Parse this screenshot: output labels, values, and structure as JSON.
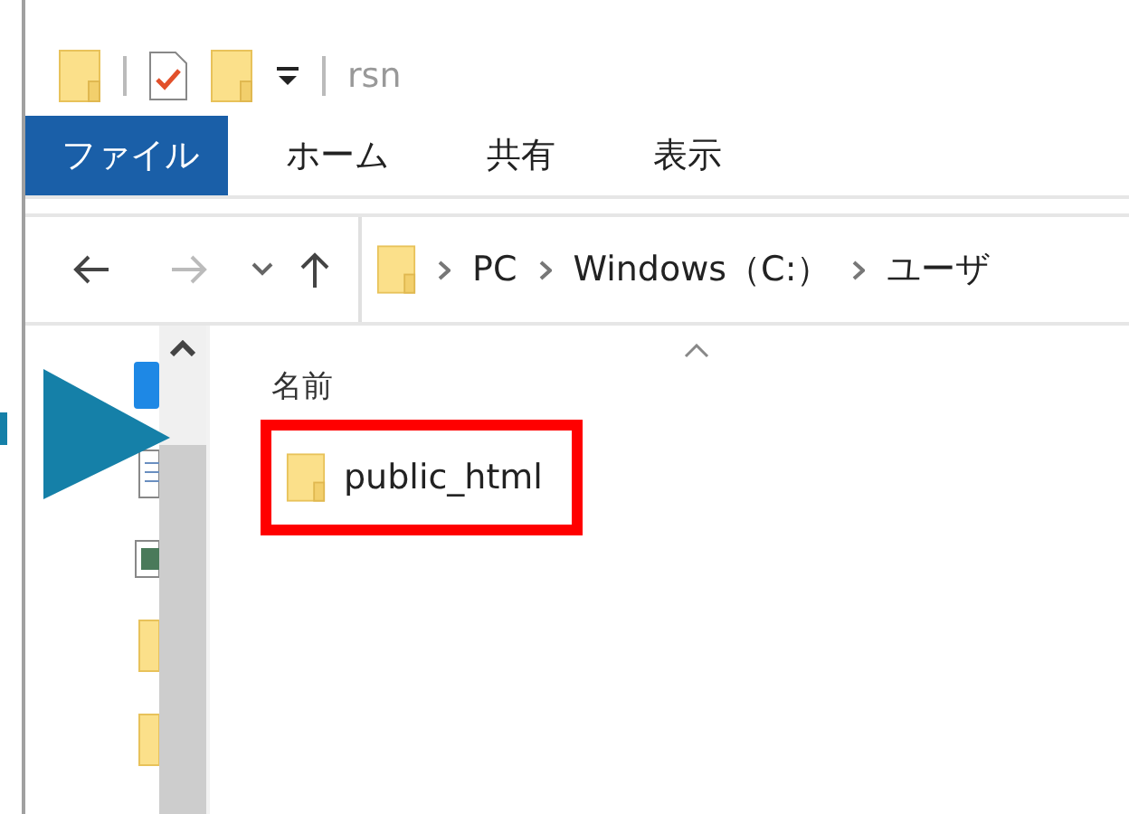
{
  "quick_access_toolbar": {
    "title": "rsn"
  },
  "ribbon_tabs": [
    {
      "label": "ファイル",
      "selected": true
    },
    {
      "label": "ホーム",
      "selected": false
    },
    {
      "label": "共有",
      "selected": false
    },
    {
      "label": "表示",
      "selected": false
    }
  ],
  "address_bar": {
    "breadcrumbs": [
      "PC",
      "Windows（C:）",
      "ユーザ"
    ]
  },
  "file_list": {
    "columns": [
      "名前"
    ],
    "items": [
      {
        "name": "public_html",
        "highlighted": true
      }
    ]
  }
}
